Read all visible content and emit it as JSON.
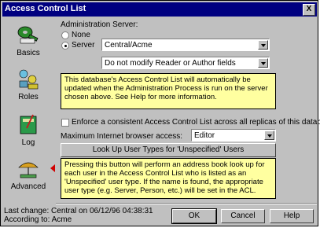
{
  "window": {
    "title": "Access Control List",
    "close_label": "X"
  },
  "sidebar": {
    "items": [
      {
        "label": "Basics",
        "icon": "key-icon"
      },
      {
        "label": "Roles",
        "icon": "roles-icon"
      },
      {
        "label": "Log",
        "icon": "log-icon"
      },
      {
        "label": "Advanced",
        "icon": "advanced-icon",
        "selected": true
      }
    ]
  },
  "admin_server": {
    "heading": "Administration Server:",
    "none_label": "None",
    "server_label": "Server",
    "selected_option": "Server",
    "server_value": "Central/Acme",
    "reader_author_value": "Do not modify Reader or Author fields"
  },
  "note1": "This database's Access Control List will automatically be updated when the Administration Process is run on the server chosen above. See Help for more information.",
  "enforce": {
    "label": "Enforce a consistent Access Control List across all replicas of this database",
    "checked": false
  },
  "internet_access": {
    "label": "Maximum Internet browser access:",
    "value": "Editor"
  },
  "lookup_button": "Look Up User Types for 'Unspecified' Users",
  "note2": "Pressing this button will perform an address book look up for each user in the Access Control List who is listed as an 'Unspecified' user type.  If the name is found, the appropriate user type (e.g. Server, Person, etc.) will be set in the ACL.",
  "footer": {
    "last_change": "Last change: Central on 06/12/96 04:38:31",
    "according_to": "According to: Acme"
  },
  "buttons": {
    "ok": "OK",
    "cancel": "Cancel",
    "help": "Help"
  },
  "colors": {
    "title_bar": "#000080",
    "note_bg": "#ffffa0",
    "selected_marker": "#d00000"
  }
}
